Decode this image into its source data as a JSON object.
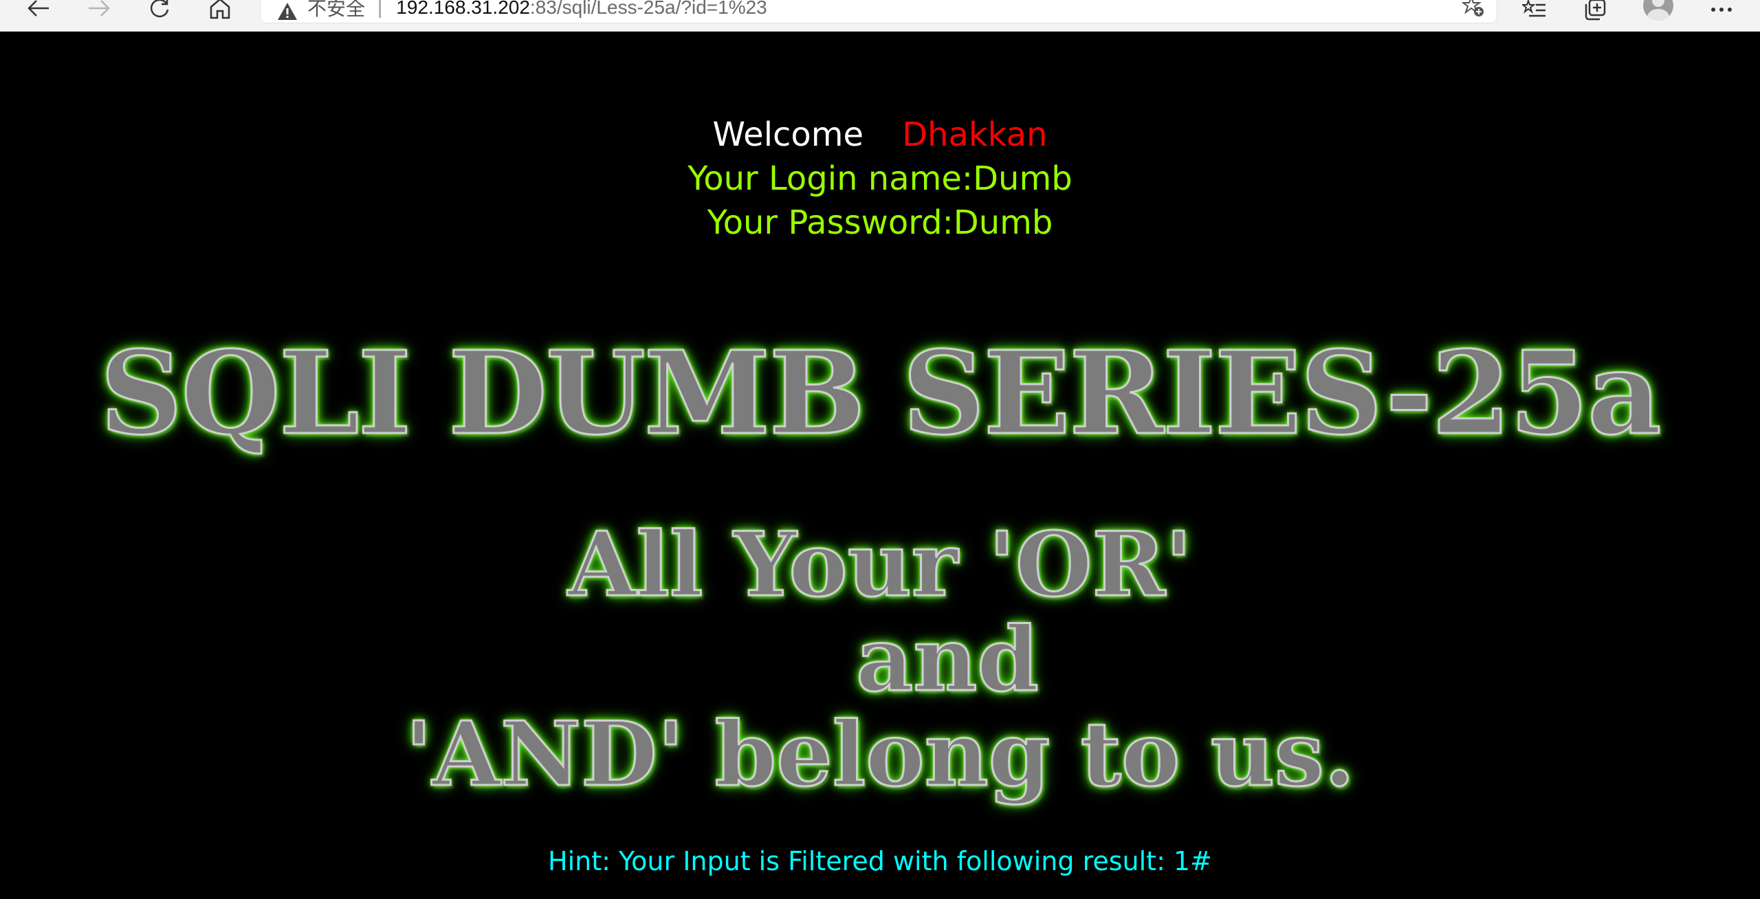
{
  "browser": {
    "security_label": "不安全",
    "separator": "|",
    "url_host": "192.168.31.202",
    "url_rest": ":83/sqli/Less-25a/?id=1%23",
    "icons": [
      "back-arrow-icon",
      "forward-arrow-icon",
      "refresh-icon",
      "home-icon",
      "warning-icon",
      "add-favorite-icon",
      "favorites-icon",
      "collections-icon",
      "profile-icon",
      "more-icon"
    ]
  },
  "page": {
    "welcome": "Welcome",
    "welcome_name": "Dhakkan",
    "login_line": "Your Login name:Dumb",
    "password_line": "Your Password:Dumb",
    "title_banner": "SQLI DUMB SERIES-25a",
    "subtitle_line1": "All Your 'OR'",
    "subtitle_line2": "and",
    "subtitle_line3": "'AND' belong to us.",
    "hint": "Hint: Your Input is Filtered with following result: 1#"
  },
  "colors": {
    "background": "#000000",
    "welcome": "#ffffff",
    "name": "#ff0000",
    "login": "#99ff00",
    "hint": "#00ffff",
    "banner_glow": "#5cf020"
  }
}
